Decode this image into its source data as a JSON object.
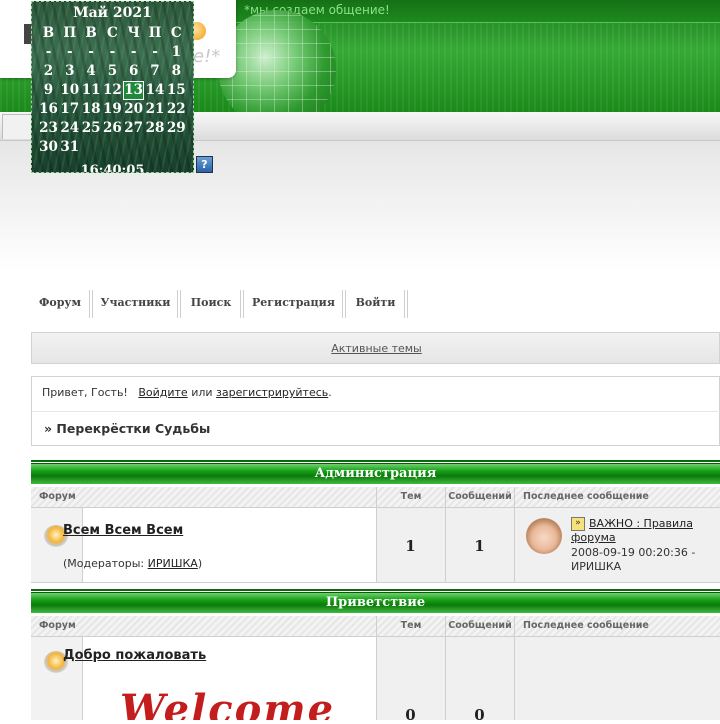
{
  "header": {
    "slogan": "*мы создаем общение!",
    "logo_tail": "e!*"
  },
  "calendar": {
    "title": "Май 2021",
    "weekdays": [
      "В",
      "П",
      "В",
      "С",
      "Ч",
      "П",
      "С"
    ],
    "weeks": [
      [
        "-",
        "-",
        "-",
        "-",
        "-",
        "-",
        "1"
      ],
      [
        "2",
        "3",
        "4",
        "5",
        "6",
        "7",
        "8"
      ],
      [
        "9",
        "10",
        "11",
        "12",
        "13",
        "14",
        "15"
      ],
      [
        "16",
        "17",
        "18",
        "19",
        "20",
        "21",
        "22"
      ],
      [
        "23",
        "24",
        "25",
        "26",
        "27",
        "28",
        "29"
      ],
      [
        "30",
        "31",
        "",
        "",
        "",
        "",
        ""
      ]
    ],
    "today": "13",
    "clock": "16:40:05"
  },
  "help_button": "?",
  "nav": {
    "items": [
      "Форум",
      "Участники",
      "Поиск",
      "Регистрация",
      "Войти"
    ]
  },
  "active_topics": "Активные темы",
  "greeting": {
    "prefix": "Привет, Гость!",
    "login": "Войдите",
    "or": "или",
    "register": "зарегистрируйтесь",
    "end": "."
  },
  "breadcrumb": "» Перекрёстки Судьбы",
  "columns": {
    "forum": "Форум",
    "topics": "Тем",
    "posts": "Сообщений",
    "last": "Последнее сообщение"
  },
  "categories": [
    {
      "title": "Администрация",
      "forum": {
        "name": "Всем Всем Всем",
        "mods_prefix": "(Модераторы:",
        "mod": "ИРИШКА",
        "mods_suffix": ")",
        "topics": "1",
        "posts": "1",
        "last": {
          "title_line1": "ВАЖНО : Правила",
          "title_line2": "форума",
          "date": "2008-09-19 00:20:36 -",
          "author": "ИРИШКА"
        }
      }
    },
    {
      "title": "Приветствие",
      "forum": {
        "name": "Добро пожаловать",
        "topics": "0",
        "posts": "0",
        "welcome_art": "Welcome"
      }
    }
  ],
  "colors": {
    "brand_green": "#1a8a1a",
    "header_green": "#0b7a0b"
  }
}
